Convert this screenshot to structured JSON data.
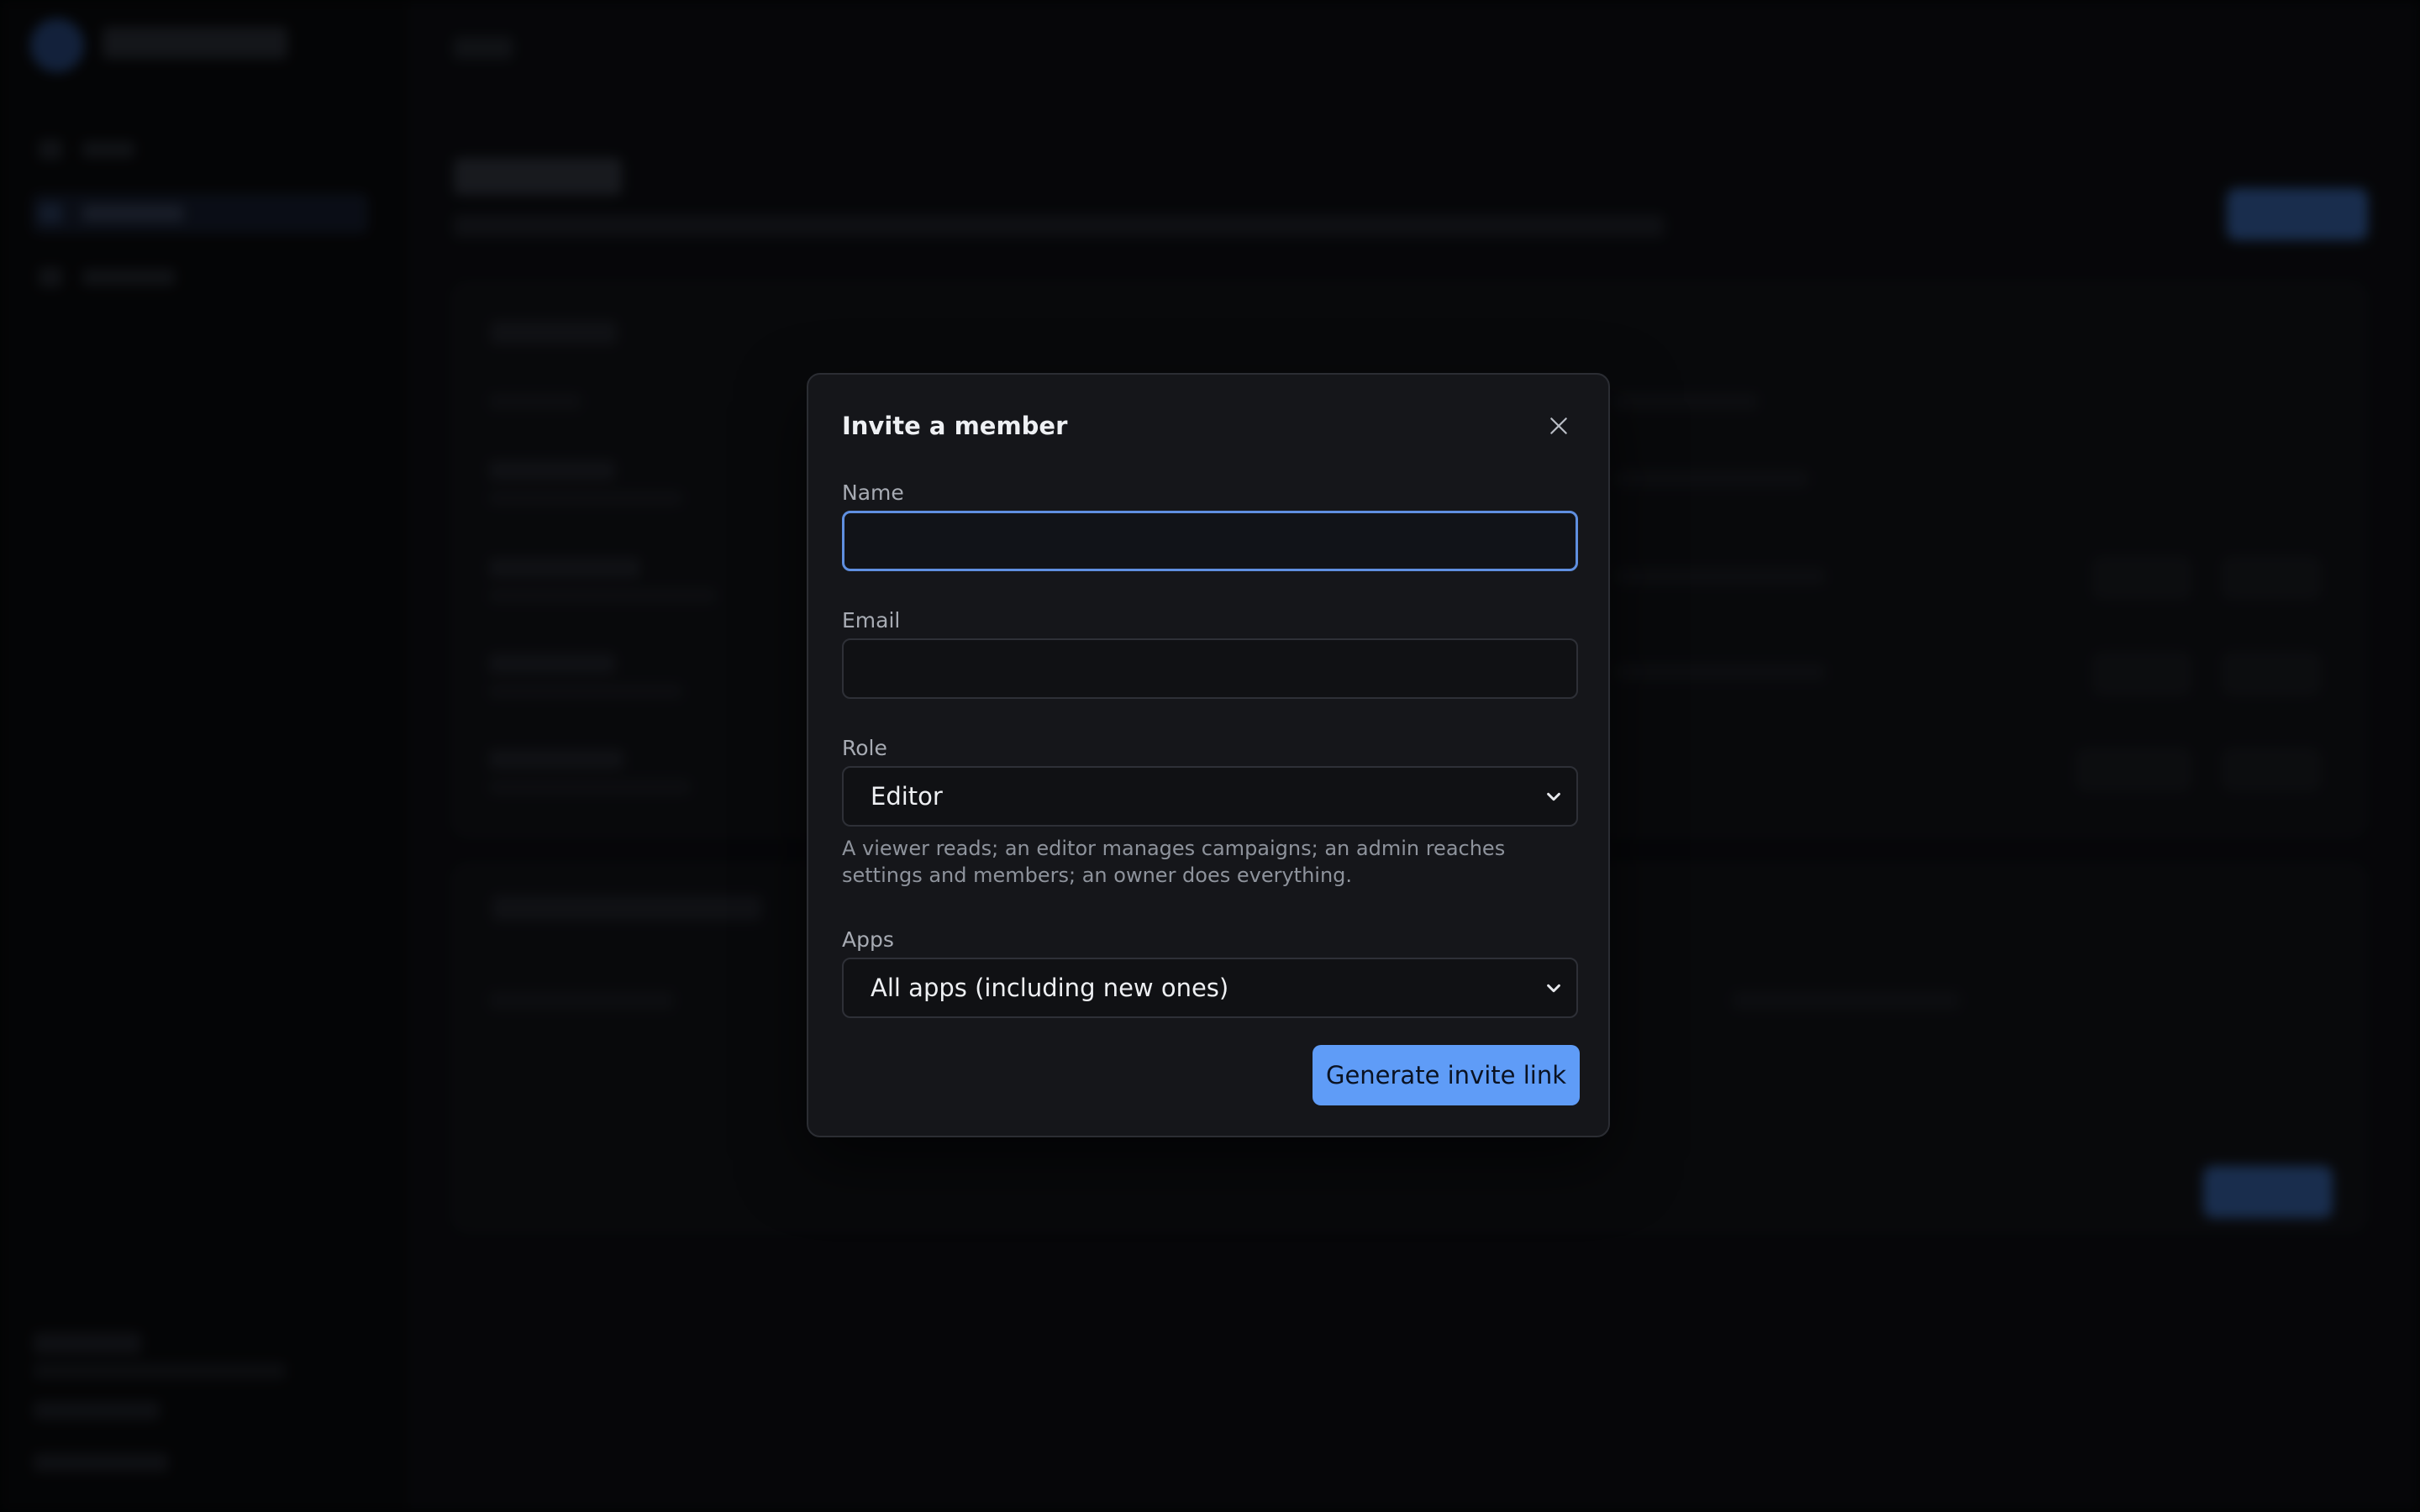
{
  "modal": {
    "title": "Invite a member",
    "close_icon": "close-icon",
    "name_label": "Name",
    "name_value": "",
    "email_label": "Email",
    "email_value": "",
    "role_label": "Role",
    "role_selected": "Editor",
    "role_hint": "A viewer reads; an editor manages campaigns; an admin reaches settings and members; an owner does everything.",
    "apps_label": "Apps",
    "apps_selected": "All apps (including new ones)",
    "generate_label": "Generate invite link"
  },
  "colors": {
    "accent": "#5f9cf7",
    "focus_border": "#5f8fe0",
    "modal_bg": "#15161a",
    "backdrop": "#040506"
  }
}
